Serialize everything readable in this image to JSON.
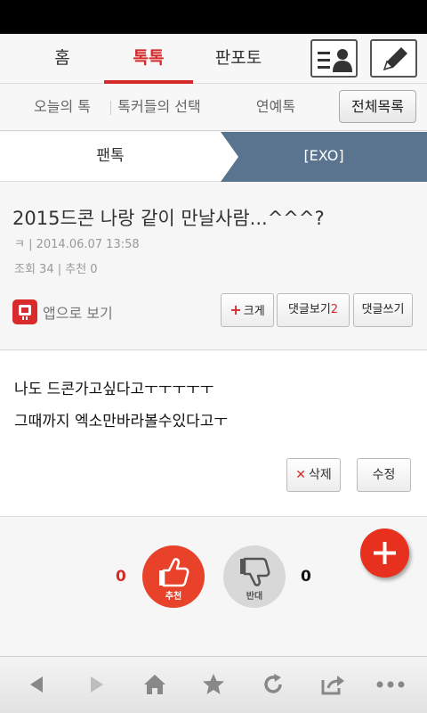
{
  "top_nav": {
    "tabs": [
      {
        "label": "홈",
        "active": false
      },
      {
        "label": "톡톡",
        "active": true
      },
      {
        "label": "판포토",
        "active": false
      }
    ],
    "icons": [
      "profile-list-icon",
      "pencil-icon"
    ]
  },
  "sub_nav": {
    "items": [
      "오늘의 톡",
      "톡커들의 선택",
      "연예톡"
    ],
    "all_button": "전체목록"
  },
  "breadcrumb": {
    "board": "팬톡",
    "category": "[EXO]"
  },
  "post": {
    "title": "2015드콘 나랑 같이 만날사람...^^^?",
    "author_date": "ㅋ | 2014.06.07 13:58",
    "stats": "조회 34 | 추천 0",
    "app_view_label": "앱으로 보기",
    "buttons": {
      "bigger": "크게",
      "comments_label": "댓글보기",
      "comments_count": "2",
      "write_comment": "댓글쓰기"
    },
    "body_lines": [
      "나도 드콘가고싶다고ㅜㅜㅜㅜㅜ",
      "그때까지 엑소만바라볼수있다고ㅜ"
    ],
    "delete_label": "삭제",
    "edit_label": "수정"
  },
  "vote": {
    "like_count": "0",
    "like_label": "추천",
    "dislike_count": "0",
    "dislike_label": "반대"
  },
  "colors": {
    "accent": "#d42a2a",
    "breadcrumb_bg": "#5a7490",
    "fab": "#e8301e"
  },
  "bottom_bar": [
    "back-icon",
    "forward-icon",
    "home-icon",
    "star-icon",
    "refresh-icon",
    "share-icon",
    "more-icon"
  ]
}
